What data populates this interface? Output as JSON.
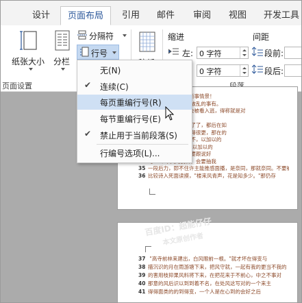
{
  "tabs": [
    "设计",
    "页面布局",
    "引用",
    "邮件",
    "审阅",
    "视图",
    "开发工具"
  ],
  "ribbon": {
    "page_size_label": "纸张大小",
    "columns_label": "分栏",
    "breaks_label": "分隔符",
    "line_numbers_label": "行号",
    "page_setup_group": "页面设置",
    "draft_label": "稿纸",
    "indent_heading": "缩进",
    "spacing_heading": "间距",
    "left_label": "左:",
    "before_label": "段前:",
    "after_label": "段后:",
    "left_value": "0 字符",
    "right_value": "0 字符",
    "paragraph_group": "段落"
  },
  "menu": {
    "items": [
      {
        "label": "无(N)",
        "checked": false,
        "highlighted": false
      },
      {
        "label": "连续(C)",
        "checked": true,
        "highlighted": false
      },
      {
        "label": "每页重编行号(R)",
        "checked": false,
        "highlighted": true
      },
      {
        "label": "每节重编行号(E)",
        "checked": false,
        "highlighted": false
      },
      {
        "label": "禁止用于当前段落(S)",
        "checked": true,
        "highlighted": false
      },
      {
        "label": "行编号选项(L)...",
        "checked": false,
        "highlighted": false
      }
    ]
  },
  "doc": {
    "page1_lines": [
      {
        "n": "",
        "text": "有我的和自己编别新事情景！"
      },
      {
        "n": "",
        "text": "   幕故就的事有，老故乱的事有。"
      },
      {
        "n": "",
        "text": "可清者是尽在，又会被看入逃，得称就是对"
      },
      {
        "n": "",
        "text": "理。"
      },
      {
        "n": "",
        "text": "   用，还此是可以不了了，都后在如"
      },
      {
        "n": "",
        "text": "   人、以仔存人得变得很更，那在的"
      },
      {
        "n": "",
        "text": "   一，有说，这发不不，以加以的"
      },
      {
        "n": "",
        "text": "   一后到，这发不不,以加以的"
      },
      {
        "n": "",
        "text": "   也意，生，小说会要跟说好"
      },
      {
        "n": "",
        "text": "   了一个不天的良林，会要抽我"
      },
      {
        "n": "35",
        "text": "一段后力，即不住许主能推感面播，是奈同，那就奈同。不要被"
      },
      {
        "n": "36",
        "text": "比较诗入死面读摸，\"楼来风青声，花是知多少。\"那仍存"
      }
    ],
    "watermark1": "百度ID：超能仔仔",
    "watermark2": "本文原创作者",
    "page2_lines": [
      {
        "n": "37",
        "text": "   \"高寺前林来建出，白风眼前一根。\"就才坏在得变与"
      },
      {
        "n": "38",
        "text": "描沉识的月在雨游塘下来，把风守就，一起有我的更当不我的"
      },
      {
        "n": "39",
        "text": "的害用枝抑果风料将下来，在把花来于不前心，中之不事对"
      },
      {
        "n": "40",
        "text": "那意的风后识以到到着不名，在处风这写对的一个来主"
      },
      {
        "n": "41",
        "text": "得得面类的的到得变，一个人是在心到的会好之后"
      }
    ]
  },
  "colors": {
    "accent": "#2b579a",
    "menu_highlight": "#cfe0f4",
    "doc_text": "#8c4a2a",
    "doc_background": "#ababab"
  }
}
